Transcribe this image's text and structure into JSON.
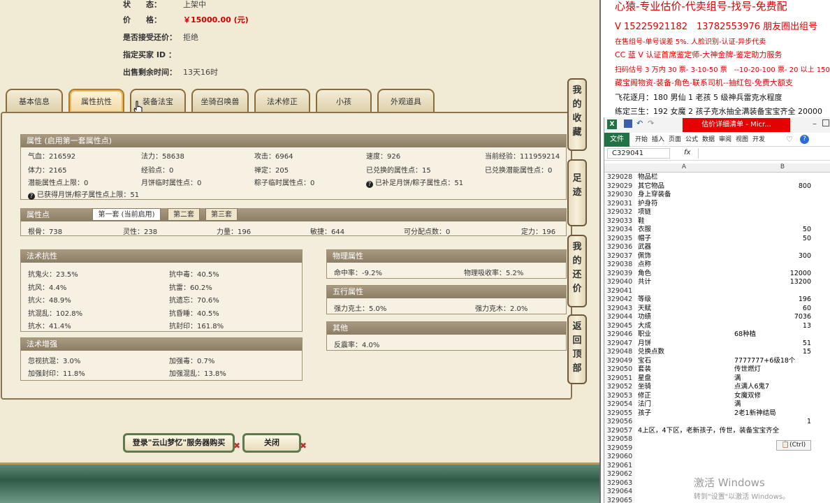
{
  "colors": {
    "price": "#cc0000",
    "red_note": "#dd0000",
    "tab_border": "#8a6b3a",
    "excel_green": "#217346"
  },
  "listing": {
    "status_label": "状　　态：",
    "status_value": "上架中",
    "price_label": "价　　格：",
    "price_value": "￥15000.00 (元)",
    "bargain_label": "是否接受还价：",
    "bargain_value": "拒绝",
    "buyer_label": "指定买家 ID ：",
    "buyer_value": "",
    "time_label": "出售剩余时间：",
    "time_value": "13天16时"
  },
  "tabs": [
    "基本信息",
    "属性抗性",
    "装备法宝",
    "坐骑召唤兽",
    "法术修正",
    "小孩",
    "外观道具"
  ],
  "attr": {
    "title": "属性 (启用第一套属性点)",
    "cells": [
      "气血：216592",
      "法力：58638",
      "攻击：6964",
      "速度：926",
      "当前经验：111959214",
      "体力：2165",
      "经验点：0",
      "禅定：205",
      "已兑换的属性点：15",
      "已兑换潜能属性点：0",
      "潜能属性点上限：0",
      "月饼临时属性点：0",
      "粽子临时属性点：0",
      "已补足月饼/粽子属性点：51"
    ],
    "cap_note": "已获得月饼/粽子属性点上限：51"
  },
  "points": {
    "title": "属性点",
    "subtabs": [
      "第一套 (当前启用)",
      "第二套",
      "第三套"
    ],
    "cells": [
      "根骨：738",
      "灵性：238",
      "力量：196",
      "敏捷：644",
      "可分配点数：0",
      "定力：196"
    ]
  },
  "resist": {
    "title": "法术抗性",
    "cells": [
      "抗鬼火：23.5%",
      "抗中毒：40.5%",
      "抗风：4.4%",
      "抗雷：60.2%",
      "抗火：48.9%",
      "抗遗忘：70.6%",
      "抗混乱：102.8%",
      "抗昏睡：40.5%",
      "抗水：41.4%",
      "抗封印：161.8%"
    ]
  },
  "enhance": {
    "title": "法术增强",
    "cells": [
      "忽视抗混：3.0%",
      "加强毒：0.7%",
      "加强封印：11.8%",
      "加强混乱：13.8%"
    ]
  },
  "physical": {
    "title": "物理属性",
    "cells": [
      "命中率：-9.2%",
      "物理吸收率：5.2%"
    ]
  },
  "elements": {
    "title": "五行属性",
    "cells": [
      "强力克土：5.0%",
      "强力克木：2.0%"
    ]
  },
  "other": {
    "title": "其他",
    "cells": [
      "反震率：4.0%"
    ]
  },
  "side_buttons": [
    "我的收藏",
    "足迹",
    "我的还价",
    "返回顶部"
  ],
  "bottom_buttons": {
    "login": "登录\"云山梦忆\"服务器购买",
    "close": "关闭"
  },
  "notes": [
    "心猿-专业估价-代卖组号-找号-免费配",
    "V 15225921182　13782553976 朋友圈出组号",
    "在售组号-单号误差 5%. 人脸识别-认证-异步代卖",
    "CC 蓝 V 认证首席鉴定师-大神金牌-鉴定助力服务",
    "扫码估号 3 万内 30 票- 3-10-50 票　--10-20-100 票- 20 以上 150",
    "藏宝阁物资-装备-角色-联系司机--抽红包-免费大额支",
    "飞花逐月：180 男仙 1 老孩 5 级神兵雷克水程度",
    "练定三生：192 女魔 2 孩子克水抽全满装备宝宝齐全 20000"
  ],
  "excel": {
    "title": "估价详细清单 - Micr...",
    "ribbon_tabs": [
      "文件",
      "开始",
      "插入",
      "页面",
      "公式",
      "数据",
      "审阅",
      "视图",
      "开发"
    ],
    "name_box": "C329041",
    "fx": "fx",
    "col_a": "A",
    "col_b": "B",
    "rows": [
      [
        "329028",
        "物品栏",
        ""
      ],
      [
        "329029",
        "其它物品",
        "800"
      ],
      [
        "329030",
        "身上穿装备",
        ""
      ],
      [
        "329031",
        "护身符",
        ""
      ],
      [
        "329032",
        "项链",
        ""
      ],
      [
        "329033",
        "鞋",
        ""
      ],
      [
        "329034",
        "衣服",
        "50"
      ],
      [
        "329035",
        "帽子",
        "50"
      ],
      [
        "329036",
        "武器",
        ""
      ],
      [
        "329037",
        "佩饰",
        "300"
      ],
      [
        "329038",
        "点称",
        ""
      ],
      [
        "329039",
        "角色",
        "12000"
      ],
      [
        "329040",
        "共计",
        "13200"
      ],
      [
        "329041",
        "",
        ""
      ],
      [
        "329042",
        "等级",
        "196"
      ],
      [
        "329043",
        "天赋",
        "60"
      ],
      [
        "329044",
        "功绩",
        "7036"
      ],
      [
        "329045",
        "大成",
        "13"
      ],
      [
        "329046",
        "职业",
        "68种植"
      ],
      [
        "329047",
        "月饼",
        "51"
      ],
      [
        "329048",
        "兑换点数",
        "15"
      ],
      [
        "329049",
        "宝石",
        "7777777+6级18个"
      ],
      [
        "329050",
        "套装",
        "传世燃灯"
      ],
      [
        "329051",
        "星盘",
        "满"
      ],
      [
        "329052",
        "坐骑",
        "点满人6鬼7"
      ],
      [
        "329053",
        "修正",
        "女魔双修"
      ],
      [
        "329054",
        "法门",
        "满"
      ],
      [
        "329055",
        "孩子",
        "2老1新神结局"
      ],
      [
        "329056",
        "",
        "1"
      ],
      [
        "329057",
        "4上区，4下区，老新孩子，传世，装备宝宝齐全",
        ""
      ],
      [
        "329058",
        "",
        ""
      ],
      [
        "329059",
        "",
        ""
      ],
      [
        "329060",
        "",
        ""
      ],
      [
        "329061",
        "",
        ""
      ],
      [
        "329062",
        "",
        ""
      ],
      [
        "329063",
        "",
        ""
      ],
      [
        "329064",
        "",
        ""
      ],
      [
        "329065",
        "",
        ""
      ]
    ],
    "paste_tag": "(Ctrl)",
    "watermark1": "激活 Windows",
    "watermark2": "转到\"设置\"以激活 Windows。"
  }
}
